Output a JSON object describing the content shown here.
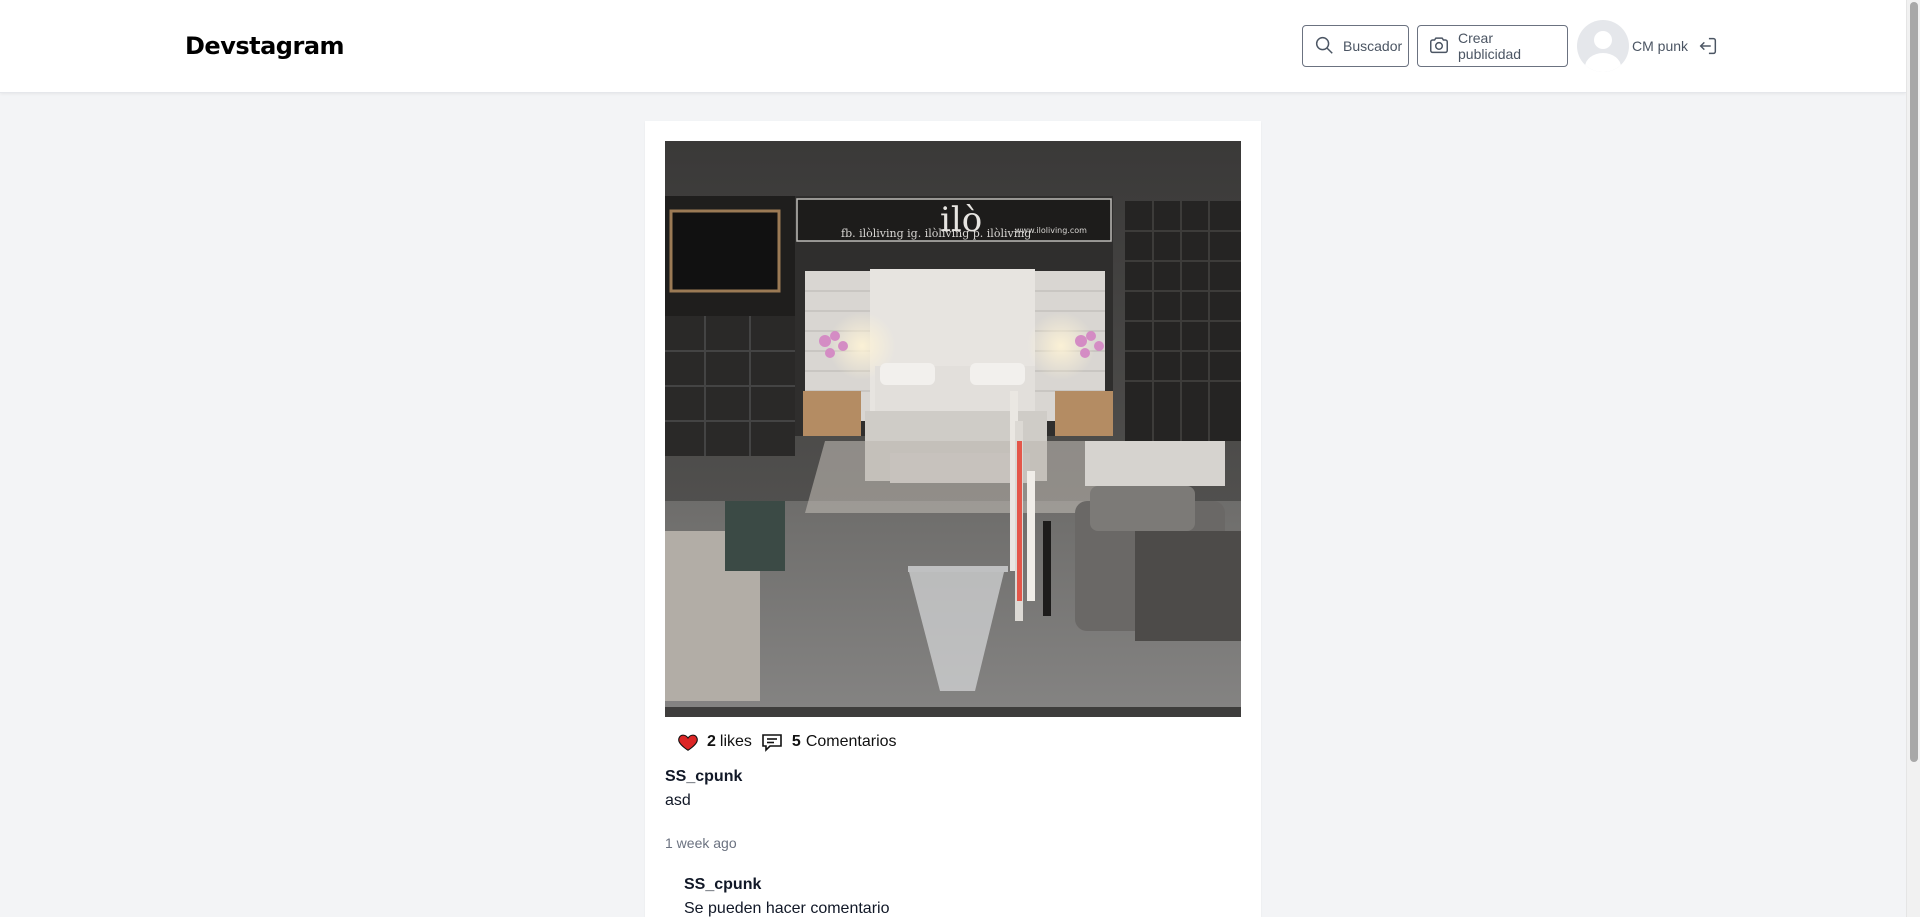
{
  "app": {
    "title": "Devstagram"
  },
  "header": {
    "search_label": "Buscador",
    "create_label": "Crear publicidad",
    "username": "CM punk"
  },
  "post": {
    "image": {
      "brand_text": "ilò",
      "banner_left": "fb. ilòliving   ig. ilòliving   p. ilòliving",
      "banner_right": "www.iloliving.com"
    },
    "likes_count": "2",
    "likes_label": "likes",
    "comments_count": "5",
    "comments_label": "Comentarios",
    "author": "SS_cpunk",
    "description": "asd",
    "time_ago": "1 week ago",
    "liked": true,
    "colors": {
      "heart": "#dc2626"
    }
  },
  "comments": [
    {
      "user": "SS_cpunk",
      "text": "Se pueden hacer comentario"
    }
  ],
  "icons": [
    "search-icon",
    "camera-icon",
    "avatar",
    "logout-icon",
    "heart-icon",
    "comment-icon"
  ]
}
